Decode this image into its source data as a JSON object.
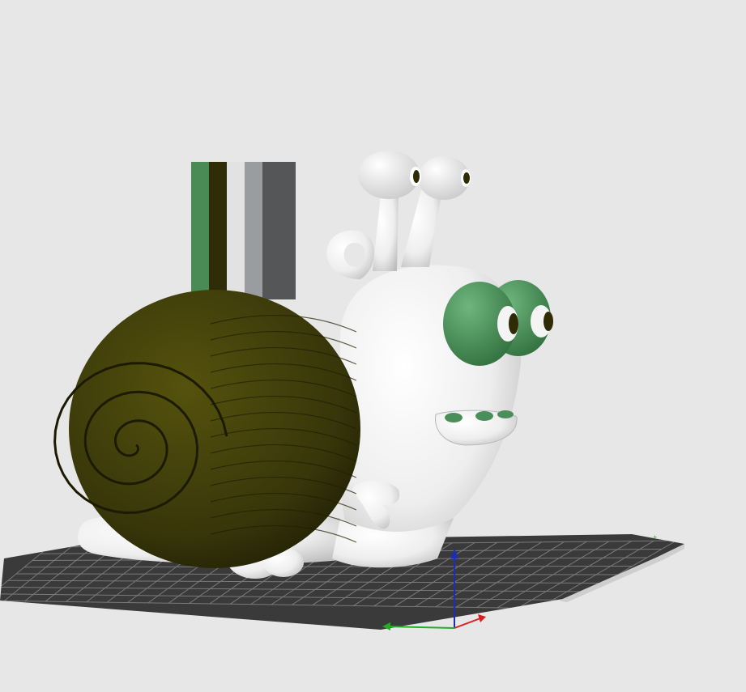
{
  "viewport": {
    "background": "#e7e7e7"
  },
  "build_plate": {
    "color": "#3a3a3a",
    "grid_color": "#7a7a7a",
    "origin_label": "+"
  },
  "model": {
    "name": "snail",
    "body_color": "#f2f2f2",
    "shell_color": "#3b3a05",
    "eye_color": "#4a8f5a",
    "pupil_color": "#2e2b05"
  },
  "purge_tower": {
    "stripe_colors": [
      "#4a8a55",
      "#2e2d07",
      "#e2e2e2",
      "#9a9d9f",
      "#555658"
    ]
  },
  "axes": {
    "x_color": "#d62020",
    "y_color": "#22b022",
    "z_color": "#1c2db8"
  }
}
